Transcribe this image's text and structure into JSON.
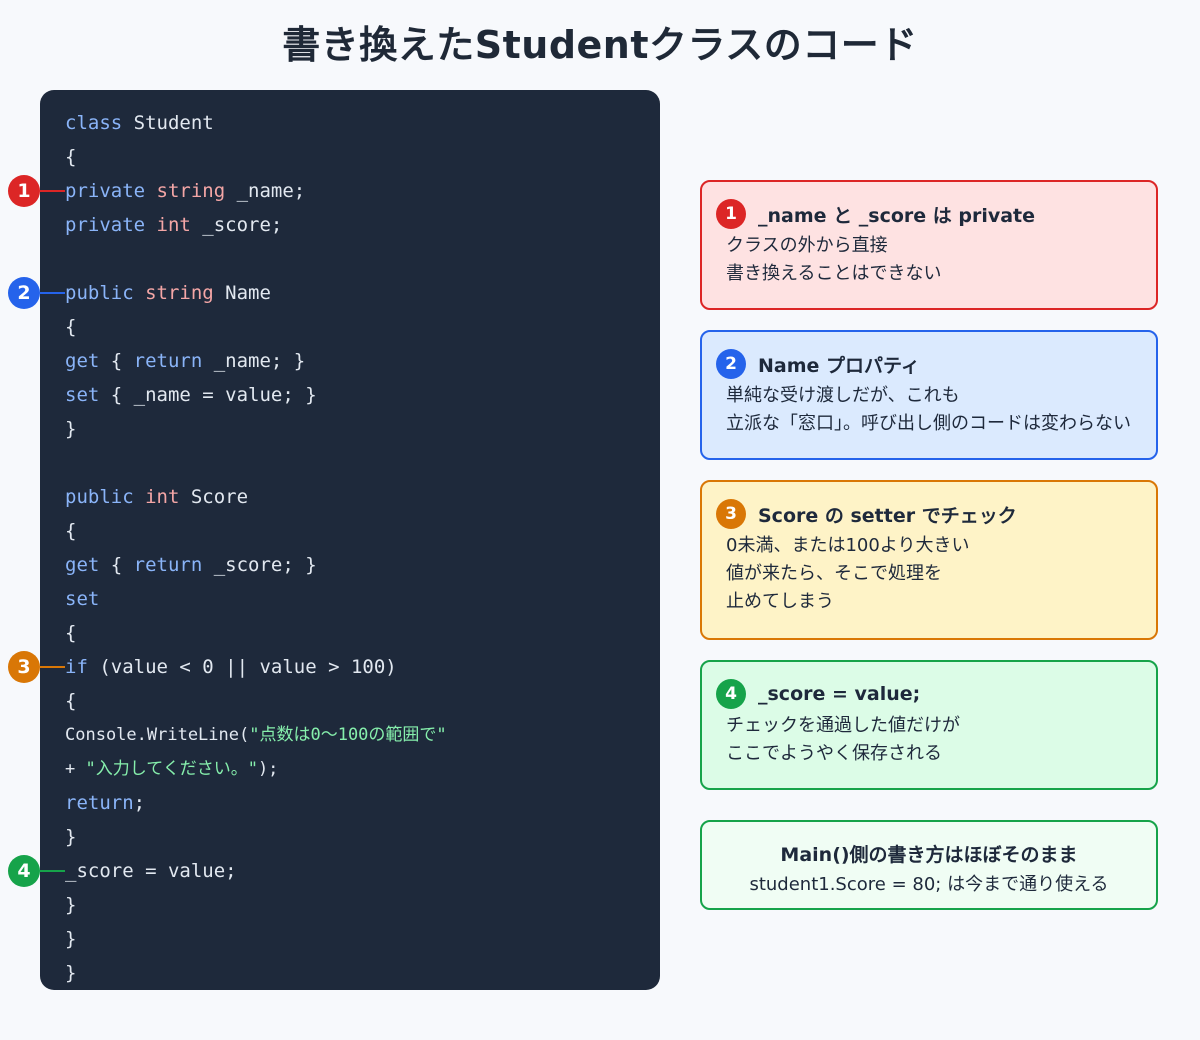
{
  "title": "書き換えたStudentクラスのコード",
  "code": [
    {
      "parts": [
        {
          "t": "class",
          "c": "kw-blue"
        },
        {
          "t": " Student"
        }
      ]
    },
    {
      "parts": [
        {
          "t": "{"
        }
      ]
    },
    {
      "parts": [
        {
          "t": "private",
          "c": "kw-blue"
        },
        {
          "t": " "
        },
        {
          "t": "string",
          "c": "kw-red"
        },
        {
          "t": " _name;"
        }
      ]
    },
    {
      "parts": [
        {
          "t": "private",
          "c": "kw-blue"
        },
        {
          "t": " "
        },
        {
          "t": "int",
          "c": "kw-red"
        },
        {
          "t": " _score;"
        }
      ]
    },
    {
      "parts": []
    },
    {
      "parts": [
        {
          "t": "public",
          "c": "kw-blue"
        },
        {
          "t": " "
        },
        {
          "t": "string",
          "c": "kw-red"
        },
        {
          "t": " Name"
        }
      ]
    },
    {
      "parts": [
        {
          "t": "{"
        }
      ]
    },
    {
      "parts": [
        {
          "t": "get",
          "c": "kw-blue"
        },
        {
          "t": " { "
        },
        {
          "t": "return",
          "c": "kw-blue"
        },
        {
          "t": " _name; }"
        }
      ]
    },
    {
      "parts": [
        {
          "t": "set",
          "c": "kw-blue"
        },
        {
          "t": " { _name = value; }"
        }
      ]
    },
    {
      "parts": [
        {
          "t": "}"
        }
      ]
    },
    {
      "parts": []
    },
    {
      "parts": [
        {
          "t": "public",
          "c": "kw-blue"
        },
        {
          "t": " "
        },
        {
          "t": "int",
          "c": "kw-red"
        },
        {
          "t": " Score"
        }
      ]
    },
    {
      "parts": [
        {
          "t": "{"
        }
      ]
    },
    {
      "parts": [
        {
          "t": "get",
          "c": "kw-blue"
        },
        {
          "t": " { "
        },
        {
          "t": "return",
          "c": "kw-blue"
        },
        {
          "t": " _score; }"
        }
      ]
    },
    {
      "parts": [
        {
          "t": "set",
          "c": "kw-blue"
        }
      ]
    },
    {
      "parts": [
        {
          "t": "{"
        }
      ]
    },
    {
      "parts": [
        {
          "t": "if",
          "c": "kw-blue"
        },
        {
          "t": " (value < 0 || value > 100)"
        }
      ]
    },
    {
      "parts": [
        {
          "t": "{"
        }
      ]
    },
    {
      "small": true,
      "parts": [
        {
          "t": "Console.WriteLine("
        },
        {
          "t": "\"点数は0〜100の範囲で\"",
          "c": "str-green"
        }
      ]
    },
    {
      "small": true,
      "parts": [
        {
          "t": "+ "
        },
        {
          "t": "\"入力してください。\"",
          "c": "str-green"
        },
        {
          "t": ");"
        }
      ]
    },
    {
      "parts": [
        {
          "t": "return",
          "c": "kw-blue"
        },
        {
          "t": ";"
        }
      ]
    },
    {
      "parts": [
        {
          "t": "}"
        }
      ]
    },
    {
      "parts": [
        {
          "t": "_score = value;"
        }
      ]
    },
    {
      "parts": [
        {
          "t": "}"
        }
      ]
    },
    {
      "parts": [
        {
          "t": "}"
        }
      ]
    },
    {
      "parts": [
        {
          "t": "}"
        }
      ]
    }
  ],
  "markers": [
    {
      "label": "1",
      "color": "#dc2626",
      "line": 2
    },
    {
      "label": "2",
      "color": "#2563eb",
      "line": 5
    },
    {
      "label": "3",
      "color": "#d97706",
      "line": 16
    },
    {
      "label": "4",
      "color": "#16a34a",
      "line": 22
    }
  ],
  "callouts": [
    {
      "number": "1",
      "title": "_name と _score は private",
      "lines": [
        "クラスの外から直接",
        "書き換えることはできない"
      ],
      "border": "#dc2626",
      "bg": "#fee2e2",
      "badge": "#dc2626"
    },
    {
      "number": "2",
      "title": "Name プロパティ",
      "lines": [
        "単純な受け渡しだが、これも",
        "立派な「窓口」。呼び出し側のコードは変わらない"
      ],
      "border": "#2563eb",
      "bg": "#dbeafe",
      "badge": "#2563eb"
    },
    {
      "number": "3",
      "title": "Score の setter でチェック",
      "lines": [
        "0未満、または100より大きい",
        "値が来たら、そこで処理を",
        "止めてしまう"
      ],
      "border": "#d97706",
      "bg": "#fef3c7",
      "badge": "#d97706"
    },
    {
      "number": "4",
      "title": "_score = value;",
      "lines": [
        "チェックを通過した値だけが",
        "ここでようやく保存される"
      ],
      "border": "#16a34a",
      "bg": "#dcfce7",
      "badge": "#16a34a"
    }
  ],
  "footer": {
    "title": "Main()側の書き方はほぼそのまま",
    "text": "student1.Score = 80; は今まで通り使える"
  }
}
